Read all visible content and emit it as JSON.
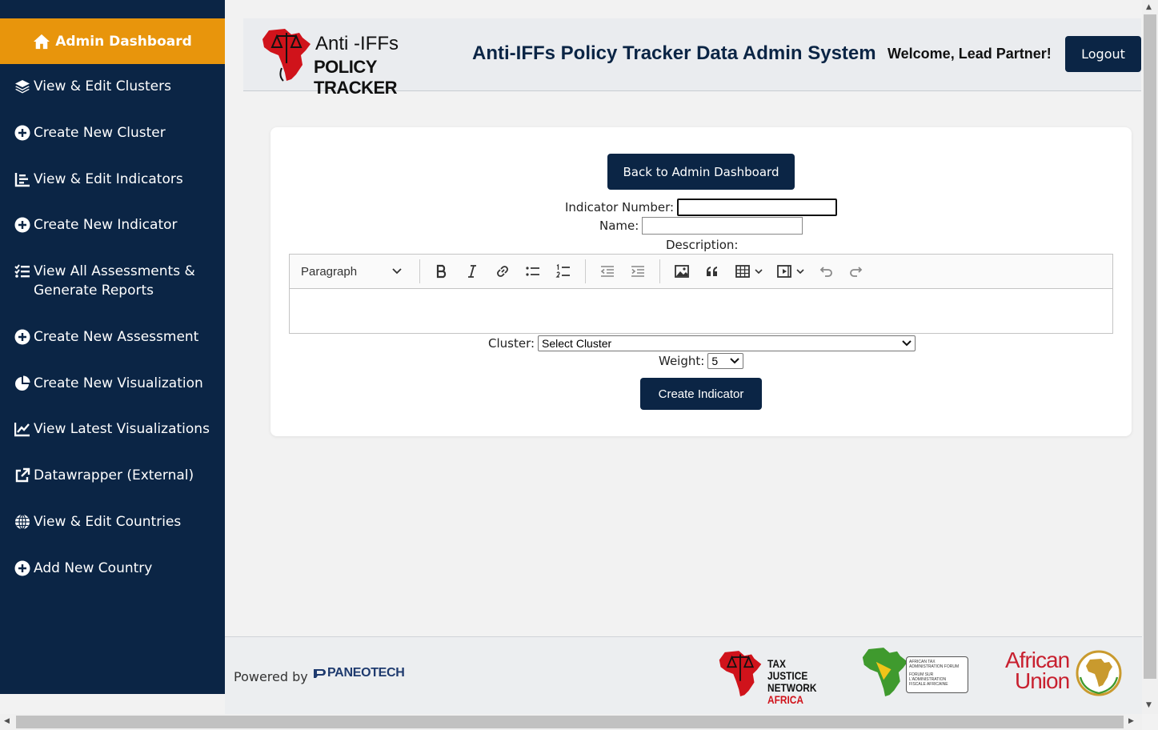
{
  "sidebar": {
    "dashboard_label": "Admin Dashboard",
    "items": [
      {
        "label": "View & Edit Clusters",
        "icon": "layers-icon"
      },
      {
        "label": "Create New Cluster",
        "icon": "plus-circle-icon"
      },
      {
        "label": "View & Edit Indicators",
        "icon": "list-chart-icon"
      },
      {
        "label": "Create New Indicator",
        "icon": "plus-circle-icon"
      },
      {
        "label": "View All Assessments & Generate Reports",
        "icon": "checklist-icon"
      },
      {
        "label": "Create New Assessment",
        "icon": "plus-circle-icon"
      },
      {
        "label": "Create New Visualization",
        "icon": "pie-chart-icon"
      },
      {
        "label": "View Latest Visualizations",
        "icon": "line-chart-icon"
      },
      {
        "label": "Datawrapper (External)",
        "icon": "external-link-icon"
      },
      {
        "label": "View & Edit Countries",
        "icon": "globe-icon"
      },
      {
        "label": "Add New Country",
        "icon": "plus-circle-icon"
      }
    ]
  },
  "header": {
    "logo_line1": "Anti -IFFs",
    "logo_line2": "POLICY TRACKER",
    "title": "Anti-IFFs Policy Tracker Data Admin System",
    "welcome": "Welcome, Lead Partner!",
    "logout_label": "Logout"
  },
  "form": {
    "back_label": "Back to Admin Dashboard",
    "indicator_number_label": "Indicator Number:",
    "indicator_number_value": "",
    "name_label": "Name:",
    "name_value": "",
    "description_label": "Description:",
    "editor_format": "Paragraph",
    "cluster_label": "Cluster:",
    "cluster_value": "Select Cluster",
    "weight_label": "Weight:",
    "weight_value": "5",
    "submit_label": "Create Indicator"
  },
  "footer": {
    "powered_by": "Powered by",
    "paneo": "PANEOTECH",
    "tjn_line1": "TAX JUSTICE",
    "tjn_line2": "NETWORK",
    "tjn_line3": "AFRICA",
    "atf_line1": "AFRICAN TAX",
    "atf_line2": "ADMINISTRATION FORUM",
    "atf_line3": "FORUM SUR",
    "atf_line4": "L'ADMINISTRATION",
    "atf_line5": "FISCALE AFRICAINE",
    "au_line1": "African",
    "au_line2": "Union"
  },
  "colors": {
    "navy": "#0b2545",
    "orange": "#e8950c",
    "africa_red": "#d0131b"
  }
}
